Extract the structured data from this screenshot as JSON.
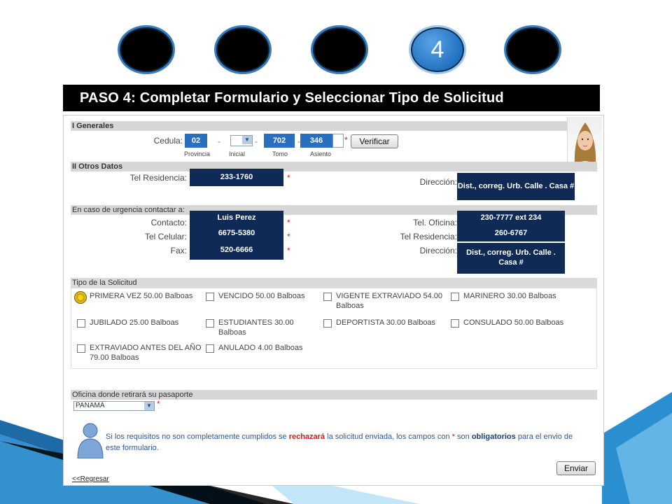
{
  "steps": [
    {
      "label": ""
    },
    {
      "label": ""
    },
    {
      "label": ""
    },
    {
      "label": "4"
    },
    {
      "label": ""
    }
  ],
  "banner": {
    "title": "PASO 4:  Completar Formulario y Seleccionar Tipo de Solicitud"
  },
  "generales": {
    "section_title": "I Generales",
    "cedula_label": "Cedula:",
    "provincia_value": "02",
    "inicial_value": "",
    "tomo_value": "702",
    "asiento_value": "346",
    "provincia_caption": "Provincia",
    "inicial_caption": "Inicial",
    "tomo_caption": "Tomo",
    "asiento_caption": "Asiento",
    "verify_button": "Verificar",
    "dash": "-",
    "required": "*"
  },
  "otros": {
    "section_title": "II Otros Datos",
    "tel_residencia_label": "Tel Residencia:",
    "tel_residencia_value": "233-1760",
    "direccion_label": "Dirección:",
    "direccion_value": "Dist., correg. Urb. Calle . Casa #"
  },
  "urgencia": {
    "section_title": "En caso de urgencia contactar a:",
    "contacto_label": "Contacto:",
    "contacto_value": "Luis Perez",
    "tel_celular_label": "Tel Celular:",
    "tel_celular_value": "6675-5380",
    "fax_label": "Fax:",
    "fax_value": "520-6666",
    "tel_oficina_label": "Tel. Oficina:",
    "tel_oficina_value": "230-7777 ext 234",
    "tel_residencia_label": "Tel Residencia:",
    "tel_residencia_value": "260-6767",
    "direccion_label": "Dirección:",
    "direccion_value": "Dist., correg. Urb. Calle . Casa #"
  },
  "tipo": {
    "section_title": "Tipo de la Solicitud",
    "options": [
      {
        "label": "PRIMERA VEZ 50.00 Balboas",
        "selected": true
      },
      {
        "label": "VENCIDO 50.00 Balboas",
        "selected": false
      },
      {
        "label": "VIGENTE EXTRAVIADO 54.00 Balboas",
        "selected": false
      },
      {
        "label": "MARINERO 30.00 Balboas",
        "selected": false
      },
      {
        "label": "JUBILADO 25.00 Balboas",
        "selected": false
      },
      {
        "label": "ESTUDIANTES 30.00 Balboas",
        "selected": false
      },
      {
        "label": "DEPORTISTA 30.00 Balboas",
        "selected": false
      },
      {
        "label": "CONSULADO 50.00 Balboas",
        "selected": false
      },
      {
        "label": "EXTRAVIADO ANTES DEL AÑO 79.00 Balboas",
        "selected": false
      },
      {
        "label": "ANULADO 4.00 Balboas",
        "selected": false
      }
    ]
  },
  "oficina": {
    "section_title": "Oficina donde retirará su pasaporte",
    "selected": "PANAMÁ",
    "required": "*"
  },
  "notice": {
    "part1": "Si los requisitos no son completamente cumplidos se ",
    "bold_red": "rechazará",
    "part2": " la solicitud enviada, los campos con ",
    "star": "*",
    "part3": " son ",
    "bold_blue": "obligatorios",
    "part4": " para el envio de este formulario."
  },
  "actions": {
    "send_button": "Enviar",
    "back_link": "<<Regresar"
  },
  "colors": {
    "accent": "#2a6fbf",
    "navy": "#0f2a55",
    "banner": "#000000",
    "required": "#d22222"
  }
}
